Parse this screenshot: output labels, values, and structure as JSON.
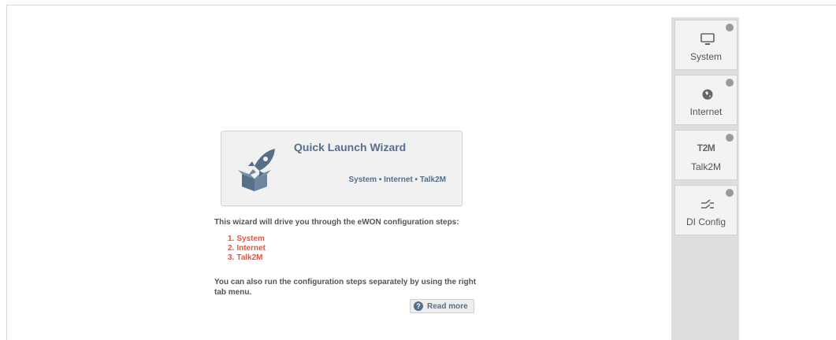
{
  "wizard": {
    "title": "Quick Launch Wizard",
    "steps_summary": "System • Internet • Talk2M",
    "icon": "rocket-box-icon"
  },
  "description": "This wizard will drive you through the eWON configuration steps:",
  "steps": [
    {
      "num": "1.",
      "label": "System"
    },
    {
      "num": "2.",
      "label": "Internet"
    },
    {
      "num": "3.",
      "label": "Talk2M"
    }
  ],
  "description2": "You can also run the configuration steps separately by using the right tab menu.",
  "read_more": {
    "label": "Read more",
    "icon": "help-icon"
  },
  "tabs": [
    {
      "label": "System",
      "icon": "monitor-icon",
      "icon_text": ""
    },
    {
      "label": "Internet",
      "icon": "globe-icon",
      "icon_text": ""
    },
    {
      "label": "Talk2M",
      "icon": "t2m-logo-icon",
      "icon_text": "T2M"
    },
    {
      "label": "DI Config",
      "icon": "switch-icon",
      "icon_text": ""
    }
  ],
  "colors": {
    "accent": "#56708a",
    "step_text": "#e8533b",
    "tab_bg": "#f3f3f3",
    "panel_bg": "#dedede"
  }
}
